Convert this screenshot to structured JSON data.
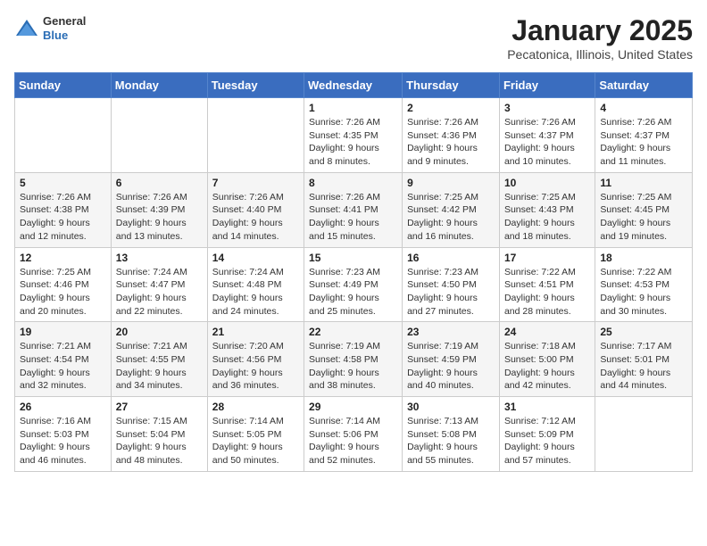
{
  "logo": {
    "general": "General",
    "blue": "Blue"
  },
  "title": "January 2025",
  "subtitle": "Pecatonica, Illinois, United States",
  "days_of_week": [
    "Sunday",
    "Monday",
    "Tuesday",
    "Wednesday",
    "Thursday",
    "Friday",
    "Saturday"
  ],
  "weeks": [
    [
      {
        "day": "",
        "info": ""
      },
      {
        "day": "",
        "info": ""
      },
      {
        "day": "",
        "info": ""
      },
      {
        "day": "1",
        "info": "Sunrise: 7:26 AM\nSunset: 4:35 PM\nDaylight: 9 hours and 8 minutes."
      },
      {
        "day": "2",
        "info": "Sunrise: 7:26 AM\nSunset: 4:36 PM\nDaylight: 9 hours and 9 minutes."
      },
      {
        "day": "3",
        "info": "Sunrise: 7:26 AM\nSunset: 4:37 PM\nDaylight: 9 hours and 10 minutes."
      },
      {
        "day": "4",
        "info": "Sunrise: 7:26 AM\nSunset: 4:37 PM\nDaylight: 9 hours and 11 minutes."
      }
    ],
    [
      {
        "day": "5",
        "info": "Sunrise: 7:26 AM\nSunset: 4:38 PM\nDaylight: 9 hours and 12 minutes."
      },
      {
        "day": "6",
        "info": "Sunrise: 7:26 AM\nSunset: 4:39 PM\nDaylight: 9 hours and 13 minutes."
      },
      {
        "day": "7",
        "info": "Sunrise: 7:26 AM\nSunset: 4:40 PM\nDaylight: 9 hours and 14 minutes."
      },
      {
        "day": "8",
        "info": "Sunrise: 7:26 AM\nSunset: 4:41 PM\nDaylight: 9 hours and 15 minutes."
      },
      {
        "day": "9",
        "info": "Sunrise: 7:25 AM\nSunset: 4:42 PM\nDaylight: 9 hours and 16 minutes."
      },
      {
        "day": "10",
        "info": "Sunrise: 7:25 AM\nSunset: 4:43 PM\nDaylight: 9 hours and 18 minutes."
      },
      {
        "day": "11",
        "info": "Sunrise: 7:25 AM\nSunset: 4:45 PM\nDaylight: 9 hours and 19 minutes."
      }
    ],
    [
      {
        "day": "12",
        "info": "Sunrise: 7:25 AM\nSunset: 4:46 PM\nDaylight: 9 hours and 20 minutes."
      },
      {
        "day": "13",
        "info": "Sunrise: 7:24 AM\nSunset: 4:47 PM\nDaylight: 9 hours and 22 minutes."
      },
      {
        "day": "14",
        "info": "Sunrise: 7:24 AM\nSunset: 4:48 PM\nDaylight: 9 hours and 24 minutes."
      },
      {
        "day": "15",
        "info": "Sunrise: 7:23 AM\nSunset: 4:49 PM\nDaylight: 9 hours and 25 minutes."
      },
      {
        "day": "16",
        "info": "Sunrise: 7:23 AM\nSunset: 4:50 PM\nDaylight: 9 hours and 27 minutes."
      },
      {
        "day": "17",
        "info": "Sunrise: 7:22 AM\nSunset: 4:51 PM\nDaylight: 9 hours and 28 minutes."
      },
      {
        "day": "18",
        "info": "Sunrise: 7:22 AM\nSunset: 4:53 PM\nDaylight: 9 hours and 30 minutes."
      }
    ],
    [
      {
        "day": "19",
        "info": "Sunrise: 7:21 AM\nSunset: 4:54 PM\nDaylight: 9 hours and 32 minutes."
      },
      {
        "day": "20",
        "info": "Sunrise: 7:21 AM\nSunset: 4:55 PM\nDaylight: 9 hours and 34 minutes."
      },
      {
        "day": "21",
        "info": "Sunrise: 7:20 AM\nSunset: 4:56 PM\nDaylight: 9 hours and 36 minutes."
      },
      {
        "day": "22",
        "info": "Sunrise: 7:19 AM\nSunset: 4:58 PM\nDaylight: 9 hours and 38 minutes."
      },
      {
        "day": "23",
        "info": "Sunrise: 7:19 AM\nSunset: 4:59 PM\nDaylight: 9 hours and 40 minutes."
      },
      {
        "day": "24",
        "info": "Sunrise: 7:18 AM\nSunset: 5:00 PM\nDaylight: 9 hours and 42 minutes."
      },
      {
        "day": "25",
        "info": "Sunrise: 7:17 AM\nSunset: 5:01 PM\nDaylight: 9 hours and 44 minutes."
      }
    ],
    [
      {
        "day": "26",
        "info": "Sunrise: 7:16 AM\nSunset: 5:03 PM\nDaylight: 9 hours and 46 minutes."
      },
      {
        "day": "27",
        "info": "Sunrise: 7:15 AM\nSunset: 5:04 PM\nDaylight: 9 hours and 48 minutes."
      },
      {
        "day": "28",
        "info": "Sunrise: 7:14 AM\nSunset: 5:05 PM\nDaylight: 9 hours and 50 minutes."
      },
      {
        "day": "29",
        "info": "Sunrise: 7:14 AM\nSunset: 5:06 PM\nDaylight: 9 hours and 52 minutes."
      },
      {
        "day": "30",
        "info": "Sunrise: 7:13 AM\nSunset: 5:08 PM\nDaylight: 9 hours and 55 minutes."
      },
      {
        "day": "31",
        "info": "Sunrise: 7:12 AM\nSunset: 5:09 PM\nDaylight: 9 hours and 57 minutes."
      },
      {
        "day": "",
        "info": ""
      }
    ]
  ]
}
